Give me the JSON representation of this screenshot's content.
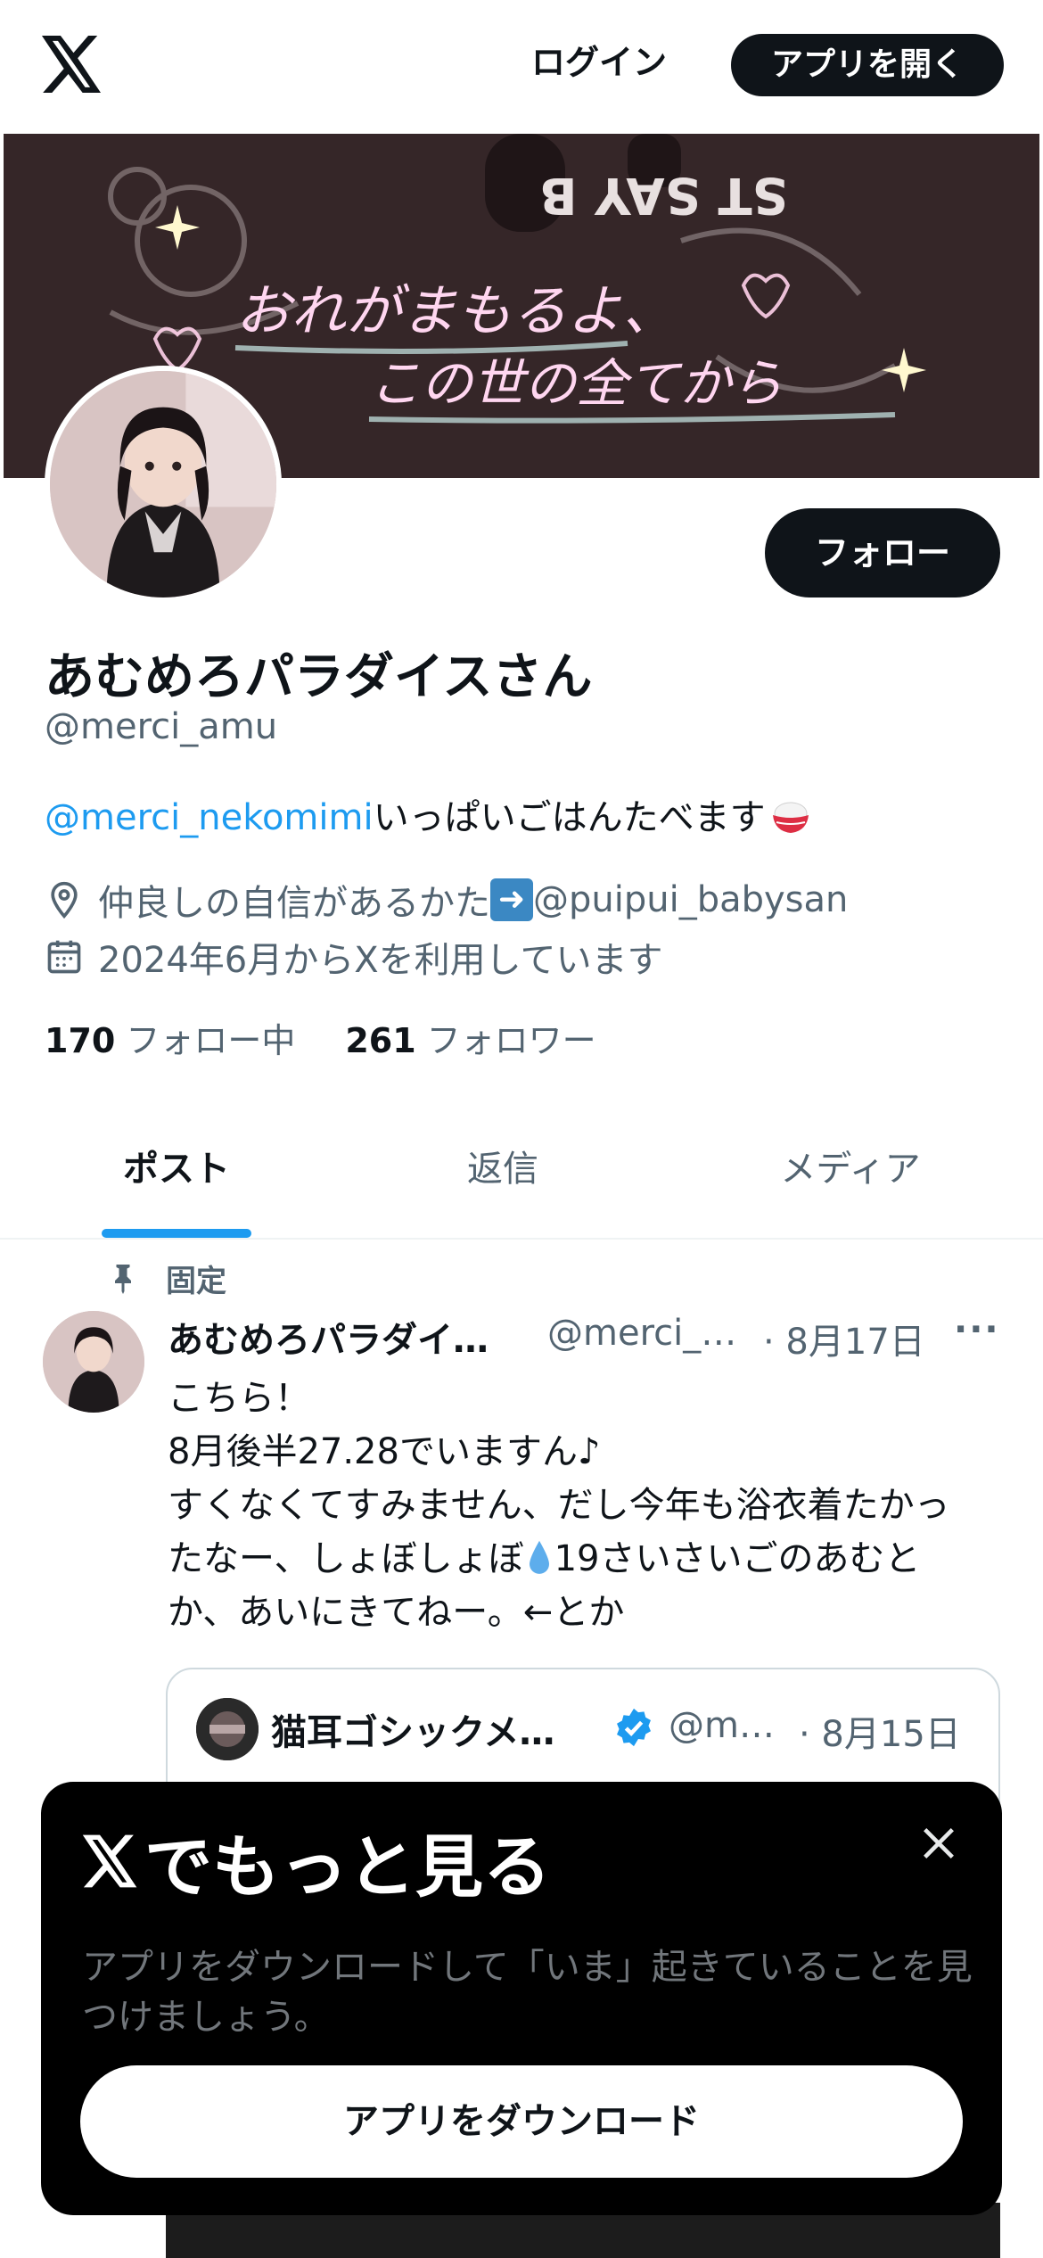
{
  "header": {
    "logo": "x-logo-icon",
    "login_label": "ログイン",
    "open_app_label": "アプリを開く"
  },
  "banner": {
    "text_line1": "おれがまもるよ、",
    "text_line2": "この世の全てから",
    "sweater_text": "ST SAY B"
  },
  "profile": {
    "display_name": "あむめろパラダイスさん",
    "handle": "@merci_amu",
    "follow_label": "フォロー",
    "bio_mention": "@merci_nekomimi",
    "bio_text": "いっぱいごはんたべます",
    "bio_emoji": "rice-bowl-icon",
    "location_prefix": "仲良しの自信があるかた",
    "location_emoji": "right-arrow-icon",
    "location_suffix": "@puipui_babysan",
    "joined": "2024年6月からXを利用しています",
    "following_count": "170",
    "following_label": "フォロー中",
    "followers_count": "261",
    "followers_label": "フォロワー"
  },
  "tabs": [
    {
      "label": "ポスト",
      "active": true
    },
    {
      "label": "返信",
      "active": false
    },
    {
      "label": "メディア",
      "active": false
    }
  ],
  "post": {
    "pinned_label": "固定",
    "author_name": "あむめろパラダイ…",
    "author_handle": "@merci_…",
    "date": "· 8月17日",
    "more": "···",
    "lines": [
      "こちら！",
      "8月後半27.28でいますん♪",
      "すくなくてすみません、だし今年も浴衣着たかっ",
      "たなー、しょぼしょぼ",
      "19さいさいごのあむと",
      "か、あいにきてねー。←とか"
    ],
    "quote": {
      "name": "猫耳ゴシックメ…",
      "handle": "@m…",
      "date": "· 8月15日",
      "verified": true
    }
  },
  "sheet": {
    "title": "でもっと見る",
    "description": "アプリをダウンロードして「いま」起きていることを見つけましょう。",
    "button_label": "アプリをダウンロード",
    "close": "close-icon"
  },
  "colors": {
    "accent": "#1d9bf0",
    "text": "#0f1419",
    "muted": "#536471",
    "button_dark": "#0f1419"
  }
}
